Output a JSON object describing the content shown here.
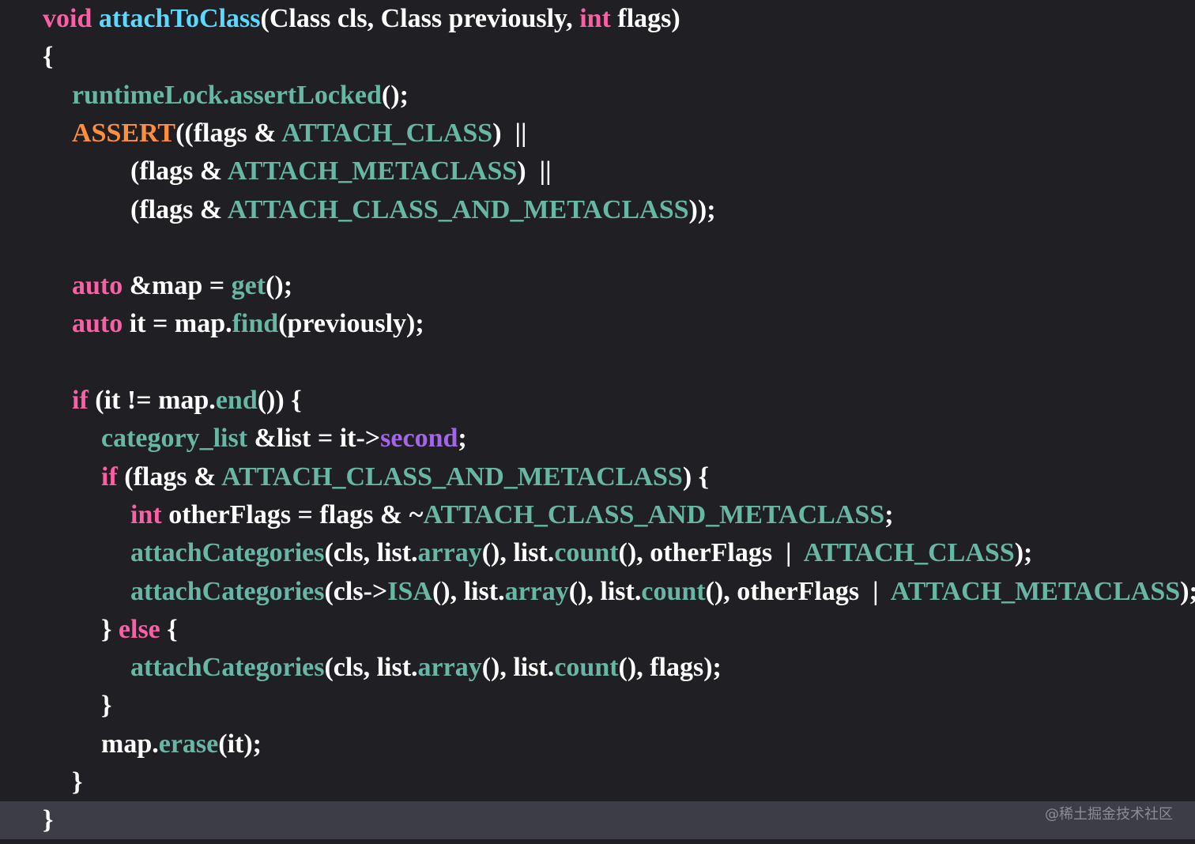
{
  "colors": {
    "background": "#1f1f24",
    "current_line": "#3c3d46",
    "plain": "#ffffff",
    "keyword": "#fc5fa3",
    "function": "#67b7a4",
    "type": "#5dd8ff",
    "macro": "#fd8f3f",
    "member": "#a167e6"
  },
  "code_lines": [
    {
      "indent": 0,
      "tokens": [
        [
          "void ",
          "keyword"
        ],
        [
          "attachToClass",
          "type"
        ],
        [
          "(Class cls, Class previously, ",
          "plain"
        ],
        [
          "int",
          "keyword"
        ],
        [
          " flags)",
          "plain"
        ]
      ]
    },
    {
      "indent": 0,
      "tokens": [
        [
          "{",
          "plain"
        ]
      ]
    },
    {
      "indent": 1,
      "tokens": [
        [
          "runtimeLock.assertLocked",
          "function"
        ],
        [
          "();",
          "plain"
        ]
      ]
    },
    {
      "indent": 1,
      "tokens": [
        [
          "ASSERT",
          "macro"
        ],
        [
          "((flags & ",
          "plain"
        ],
        [
          "ATTACH_CLASS",
          "function"
        ],
        [
          ")  ||",
          "plain"
        ]
      ]
    },
    {
      "indent": 3,
      "tokens": [
        [
          "(flags & ",
          "plain"
        ],
        [
          "ATTACH_METACLASS",
          "function"
        ],
        [
          ")  ||",
          "plain"
        ]
      ]
    },
    {
      "indent": 3,
      "tokens": [
        [
          "(flags & ",
          "plain"
        ],
        [
          "ATTACH_CLASS_AND_METACLASS",
          "function"
        ],
        [
          "));",
          "plain"
        ]
      ]
    },
    {
      "indent": 0,
      "tokens": []
    },
    {
      "indent": 1,
      "tokens": [
        [
          "auto",
          "keyword"
        ],
        [
          " &map = ",
          "plain"
        ],
        [
          "get",
          "function"
        ],
        [
          "();",
          "plain"
        ]
      ]
    },
    {
      "indent": 1,
      "tokens": [
        [
          "auto",
          "keyword"
        ],
        [
          " it = map.",
          "plain"
        ],
        [
          "find",
          "function"
        ],
        [
          "(previously);",
          "plain"
        ]
      ]
    },
    {
      "indent": 0,
      "tokens": []
    },
    {
      "indent": 1,
      "tokens": [
        [
          "if",
          "keyword"
        ],
        [
          " (it != map.",
          "plain"
        ],
        [
          "end",
          "function"
        ],
        [
          "()) {",
          "plain"
        ]
      ]
    },
    {
      "indent": 2,
      "tokens": [
        [
          "category_list",
          "function"
        ],
        [
          " &list = it->",
          "plain"
        ],
        [
          "second",
          "member"
        ],
        [
          ";",
          "plain"
        ]
      ]
    },
    {
      "indent": 2,
      "tokens": [
        [
          "if",
          "keyword"
        ],
        [
          " (flags & ",
          "plain"
        ],
        [
          "ATTACH_CLASS_AND_METACLASS",
          "function"
        ],
        [
          ") {",
          "plain"
        ]
      ]
    },
    {
      "indent": 3,
      "tokens": [
        [
          "int",
          "keyword"
        ],
        [
          " otherFlags = flags & ~",
          "plain"
        ],
        [
          "ATTACH_CLASS_AND_METACLASS",
          "function"
        ],
        [
          ";",
          "plain"
        ]
      ]
    },
    {
      "indent": 3,
      "tokens": [
        [
          "attachCategories",
          "function"
        ],
        [
          "(cls, list.",
          "plain"
        ],
        [
          "array",
          "function"
        ],
        [
          "(), list.",
          "plain"
        ],
        [
          "count",
          "function"
        ],
        [
          "(), otherFlags  |  ",
          "plain"
        ],
        [
          "ATTACH_CLASS",
          "function"
        ],
        [
          ");",
          "plain"
        ]
      ]
    },
    {
      "indent": 3,
      "tokens": [
        [
          "attachCategories",
          "function"
        ],
        [
          "(cls->",
          "plain"
        ],
        [
          "ISA",
          "function"
        ],
        [
          "(), list.",
          "plain"
        ],
        [
          "array",
          "function"
        ],
        [
          "(), list.",
          "plain"
        ],
        [
          "count",
          "function"
        ],
        [
          "(), otherFlags  |  ",
          "plain"
        ],
        [
          "ATTACH_METACLASS",
          "function"
        ],
        [
          ");",
          "plain"
        ]
      ]
    },
    {
      "indent": 2,
      "tokens": [
        [
          "} ",
          "plain"
        ],
        [
          "else",
          "keyword"
        ],
        [
          " {",
          "plain"
        ]
      ]
    },
    {
      "indent": 3,
      "tokens": [
        [
          "attachCategories",
          "function"
        ],
        [
          "(cls, list.",
          "plain"
        ],
        [
          "array",
          "function"
        ],
        [
          "(), list.",
          "plain"
        ],
        [
          "count",
          "function"
        ],
        [
          "(), flags);",
          "plain"
        ]
      ]
    },
    {
      "indent": 2,
      "tokens": [
        [
          "}",
          "plain"
        ]
      ]
    },
    {
      "indent": 2,
      "tokens": [
        [
          "map.",
          "plain"
        ],
        [
          "erase",
          "function"
        ],
        [
          "(it);",
          "plain"
        ]
      ]
    },
    {
      "indent": 1,
      "tokens": [
        [
          "}",
          "plain"
        ]
      ]
    },
    {
      "indent": 0,
      "tokens": [
        [
          "}",
          "plain"
        ]
      ],
      "current": true
    }
  ],
  "watermark": "@稀土掘金技术社区"
}
